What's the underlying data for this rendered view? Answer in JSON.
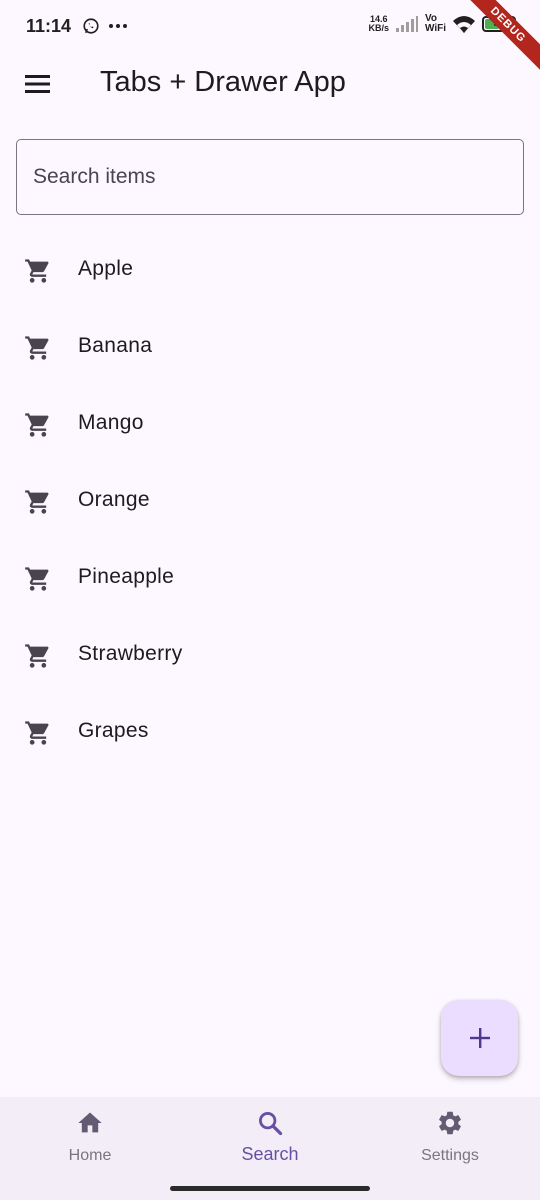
{
  "status_bar": {
    "time": "11:14",
    "net_speed_value": "14.6",
    "net_speed_unit": "KB/s",
    "vo_label": "Vo",
    "wifi_label": "WiFi",
    "battery_level": "52",
    "icons": [
      "whatsapp-icon",
      "more-dots-icon",
      "signal-icon",
      "wifi-icon",
      "battery-icon"
    ]
  },
  "debug_banner": "DEBUG",
  "app_bar": {
    "title": "Tabs + Drawer App",
    "menu_icon": "menu-icon"
  },
  "search": {
    "placeholder": "Search items",
    "value": ""
  },
  "items": [
    {
      "label": "Apple",
      "icon": "cart-icon"
    },
    {
      "label": "Banana",
      "icon": "cart-icon"
    },
    {
      "label": "Mango",
      "icon": "cart-icon"
    },
    {
      "label": "Orange",
      "icon": "cart-icon"
    },
    {
      "label": "Pineapple",
      "icon": "cart-icon"
    },
    {
      "label": "Strawberry",
      "icon": "cart-icon"
    },
    {
      "label": "Grapes",
      "icon": "cart-icon"
    }
  ],
  "fab": {
    "icon": "add-icon"
  },
  "bottom_nav": {
    "active_tab": "Search",
    "tabs": [
      {
        "label": "Home",
        "icon": "home-icon"
      },
      {
        "label": "Search",
        "icon": "search-icon"
      },
      {
        "label": "Settings",
        "icon": "settings-icon"
      }
    ]
  },
  "colors": {
    "background": "#fdf7ff",
    "primary": "#6750a4",
    "fab_background": "#eaddff",
    "nav_background": "#f3edf7",
    "icon_gray": "#49454f",
    "battery_green": "#4caf50",
    "debug_red": "#b3261e"
  }
}
